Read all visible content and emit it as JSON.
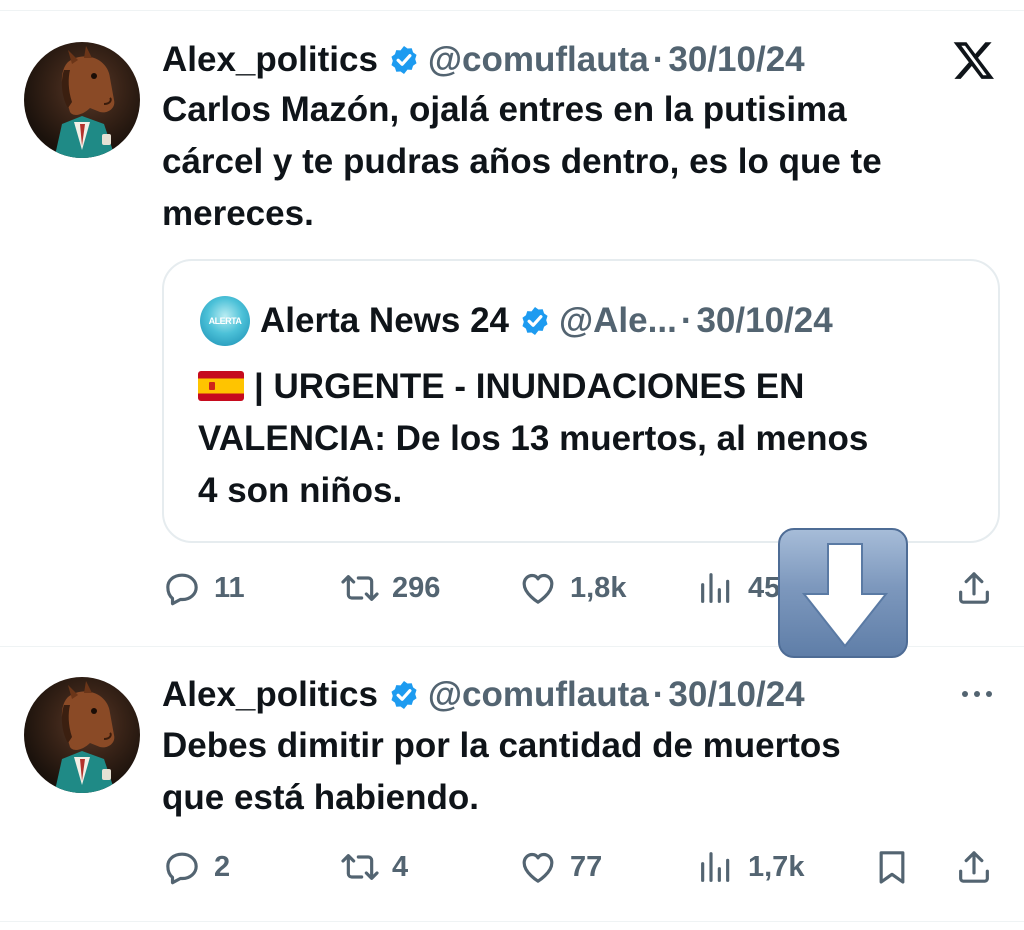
{
  "tweets": [
    {
      "name": "Alex_politics",
      "handle": "@comuflauta",
      "separator": "·",
      "date": "30/10/24",
      "text": "Carlos Mazón, ojalá entres en la putisima cárcel y te pudras años dentro, es lo que te mereces.",
      "text_lines": [
        "Carlos Mazón, ojalá entres en la putisima",
        "cárcel y te pudras años dentro, es lo que te",
        "mereces."
      ],
      "quote": {
        "name": "Alerta News 24",
        "avatar_text": "ALERTA NEWS 24",
        "handle": "@Ale...",
        "separator": "·",
        "date": "30/10/24",
        "flag": "spain-flag-icon",
        "text_lines": [
          "| URGENTE - INUNDACIONES EN",
          "VALENCIA: De los 13 muertos, al menos",
          "4 son niños."
        ]
      },
      "stats": {
        "replies": "11",
        "reposts": "296",
        "likes": "1,8k",
        "views": "45"
      }
    },
    {
      "name": "Alex_politics",
      "handle": "@comuflauta",
      "separator": "·",
      "date": "30/10/24",
      "text_lines": [
        "Debes dimitir por la cantidad de muertos",
        "que está habiendo."
      ],
      "stats": {
        "replies": "2",
        "reposts": "4",
        "likes": "77",
        "views": "1,7k"
      }
    }
  ],
  "icons": {
    "brand": "x-logo-icon",
    "verified": "verified-badge-icon",
    "overlay": "download-arrow-icon"
  },
  "colors": {
    "text": "#0f1419",
    "secondary": "#536471",
    "verified": "#1d9bf0",
    "border": "#e6ecef"
  }
}
